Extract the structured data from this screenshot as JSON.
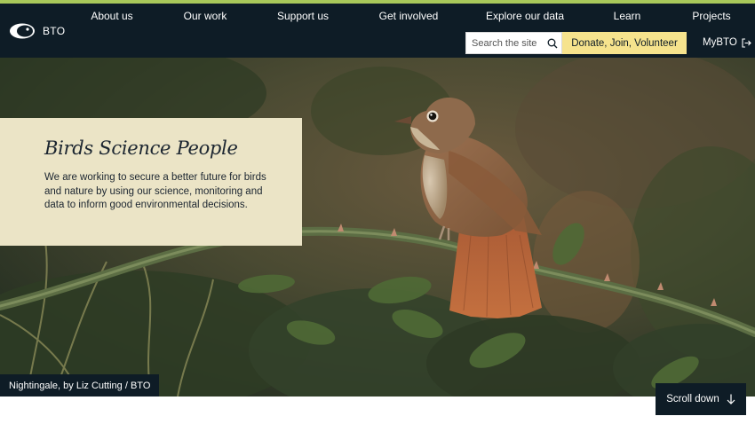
{
  "brand": {
    "logo_text": "BTO",
    "accent": "#a8c85a",
    "header_bg": "#0e1c26"
  },
  "nav": {
    "items": [
      {
        "label": "About us"
      },
      {
        "label": "Our work"
      },
      {
        "label": "Support us"
      },
      {
        "label": "Get involved"
      },
      {
        "label": "Explore our data"
      },
      {
        "label": "Learn"
      },
      {
        "label": "Projects"
      }
    ]
  },
  "search": {
    "placeholder": "Search the site",
    "icon": "search-icon"
  },
  "donate": {
    "label": "Donate, Join, Volunteer",
    "color": "#f6e38d"
  },
  "account": {
    "label": "MyBTO",
    "icon": "login-icon"
  },
  "hero": {
    "title": "Birds Science People",
    "text": "We are working to secure a better future for birds and nature by using our science, monitoring and data to inform good environmental decisions.",
    "caption": "Nightingale, by Liz Cutting / BTO",
    "panel_color": "#ebe4c6"
  },
  "scroll": {
    "label": "Scroll down",
    "icon": "arrow-down-icon"
  }
}
